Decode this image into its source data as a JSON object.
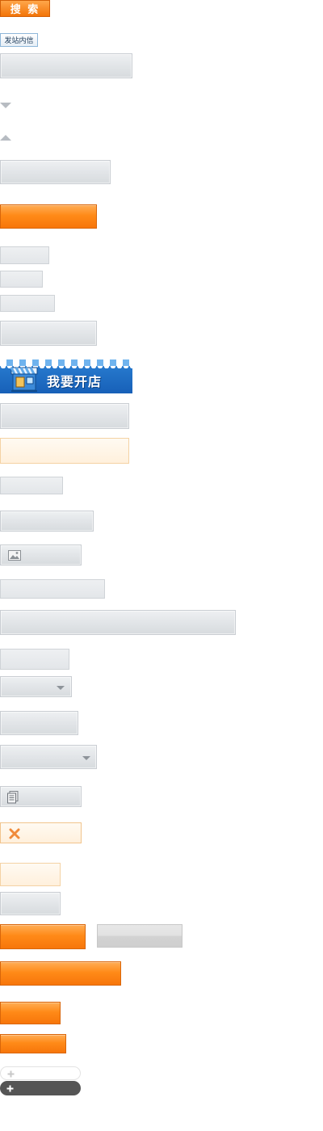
{
  "search_button": {
    "label": "搜 索"
  },
  "message_button": {
    "label": "发站内信"
  },
  "shop_banner": {
    "label": "我要开店"
  },
  "icons": {
    "down": "chevron-down-icon",
    "up": "chevron-up-icon",
    "image": "image-icon",
    "document": "document-icon",
    "close": "close-icon",
    "plus": "plus-icon"
  },
  "colors": {
    "orange": "#ff8a18",
    "orange_border": "#d9660a",
    "gray_border": "#c9cdd2",
    "shop_blue": "#1f6fc4",
    "close_orange": "#f08a3a"
  }
}
